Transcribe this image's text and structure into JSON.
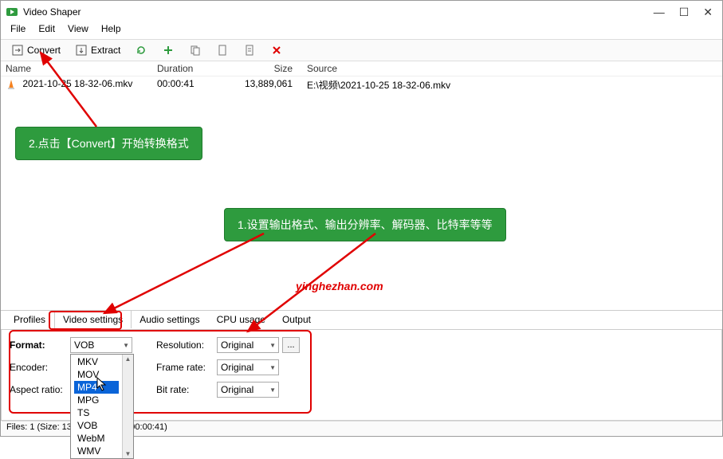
{
  "app": {
    "title": "Video Shaper"
  },
  "menu": {
    "file": "File",
    "edit": "Edit",
    "view": "View",
    "help": "Help"
  },
  "toolbar": {
    "convert": "Convert",
    "extract": "Extract"
  },
  "columns": {
    "name": "Name",
    "duration": "Duration",
    "size": "Size",
    "source": "Source"
  },
  "row": {
    "name": "2021-10-25 18-32-06.mkv",
    "duration": "00:00:41",
    "size": "13,889,061",
    "source": "E:\\视频\\2021-10-25 18-32-06.mkv"
  },
  "badges": {
    "one": "2.点击【Convert】开始转换格式",
    "two": "1.设置输出格式、输出分辨率、解码器、比特率等等"
  },
  "watermark": "yinghezhan.com",
  "tabs": {
    "profiles": "Profiles",
    "video": "Video settings",
    "audio": "Audio settings",
    "cpu": "CPU usage",
    "output": "Output"
  },
  "settings": {
    "format_label": "Format:",
    "encoder_label": "Encoder:",
    "aspect_label": "Aspect ratio:",
    "resolution_label": "Resolution:",
    "frame_label": "Frame rate:",
    "bitrate_label": "Bit rate:",
    "format_value": "VOB",
    "resolution_value": "Original",
    "frame_value": "Original",
    "bitrate_value": "Original",
    "ellipsis": "...",
    "options": {
      "mkv": "MKV",
      "mov": "MOV",
      "mp4": "MP4",
      "mpg": "MPG",
      "ts": "TS",
      "vob": "VOB",
      "webm": "WebM",
      "wmv": "WMV"
    }
  },
  "status": "Files: 1 (Size: 13 MB, Duration: 00:00:41)"
}
